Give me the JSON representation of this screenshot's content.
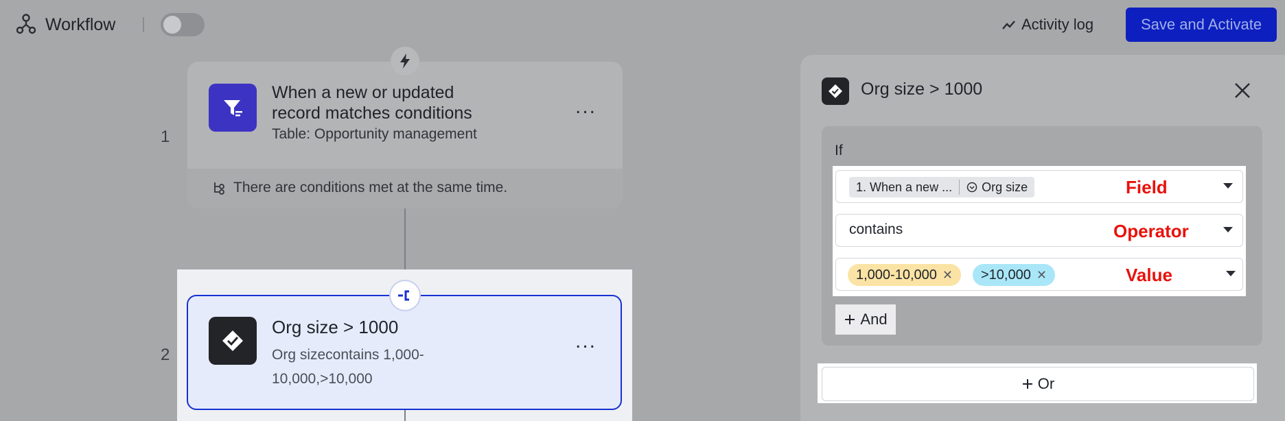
{
  "header": {
    "title": "Workflow",
    "activity_log": "Activity log",
    "save_button": "Save and Activate",
    "toggle_on": false
  },
  "canvas": {
    "steps": [
      {
        "number": "1",
        "title": "When a new or updated record matches conditions",
        "subtitle": "Table: Opportunity management",
        "footer": "There are conditions met at the same time.",
        "icon": "filter-icon",
        "menu": "..."
      },
      {
        "number": "2",
        "title": "Org size > 1000",
        "subtitle": "Org sizecontains 1,000-10,000,>10,000",
        "icon": "check-diamond-icon",
        "menu": "..."
      }
    ]
  },
  "panel": {
    "title": "Org size > 1000",
    "if_label": "If",
    "field": {
      "source": "1. When a new ...",
      "name": "Org size",
      "annotation": "Field"
    },
    "operator": {
      "value": "contains",
      "annotation": "Operator"
    },
    "value": {
      "tags": [
        "1,000-10,000",
        ">10,000"
      ],
      "annotation": "Value"
    },
    "and_button": "And",
    "or_button": "Or"
  },
  "colors": {
    "primary": "#0e1fbf",
    "annotation_red": "#e8120c",
    "tag_yellow": "#fae3a4",
    "tag_blue": "#a9e6f8"
  }
}
